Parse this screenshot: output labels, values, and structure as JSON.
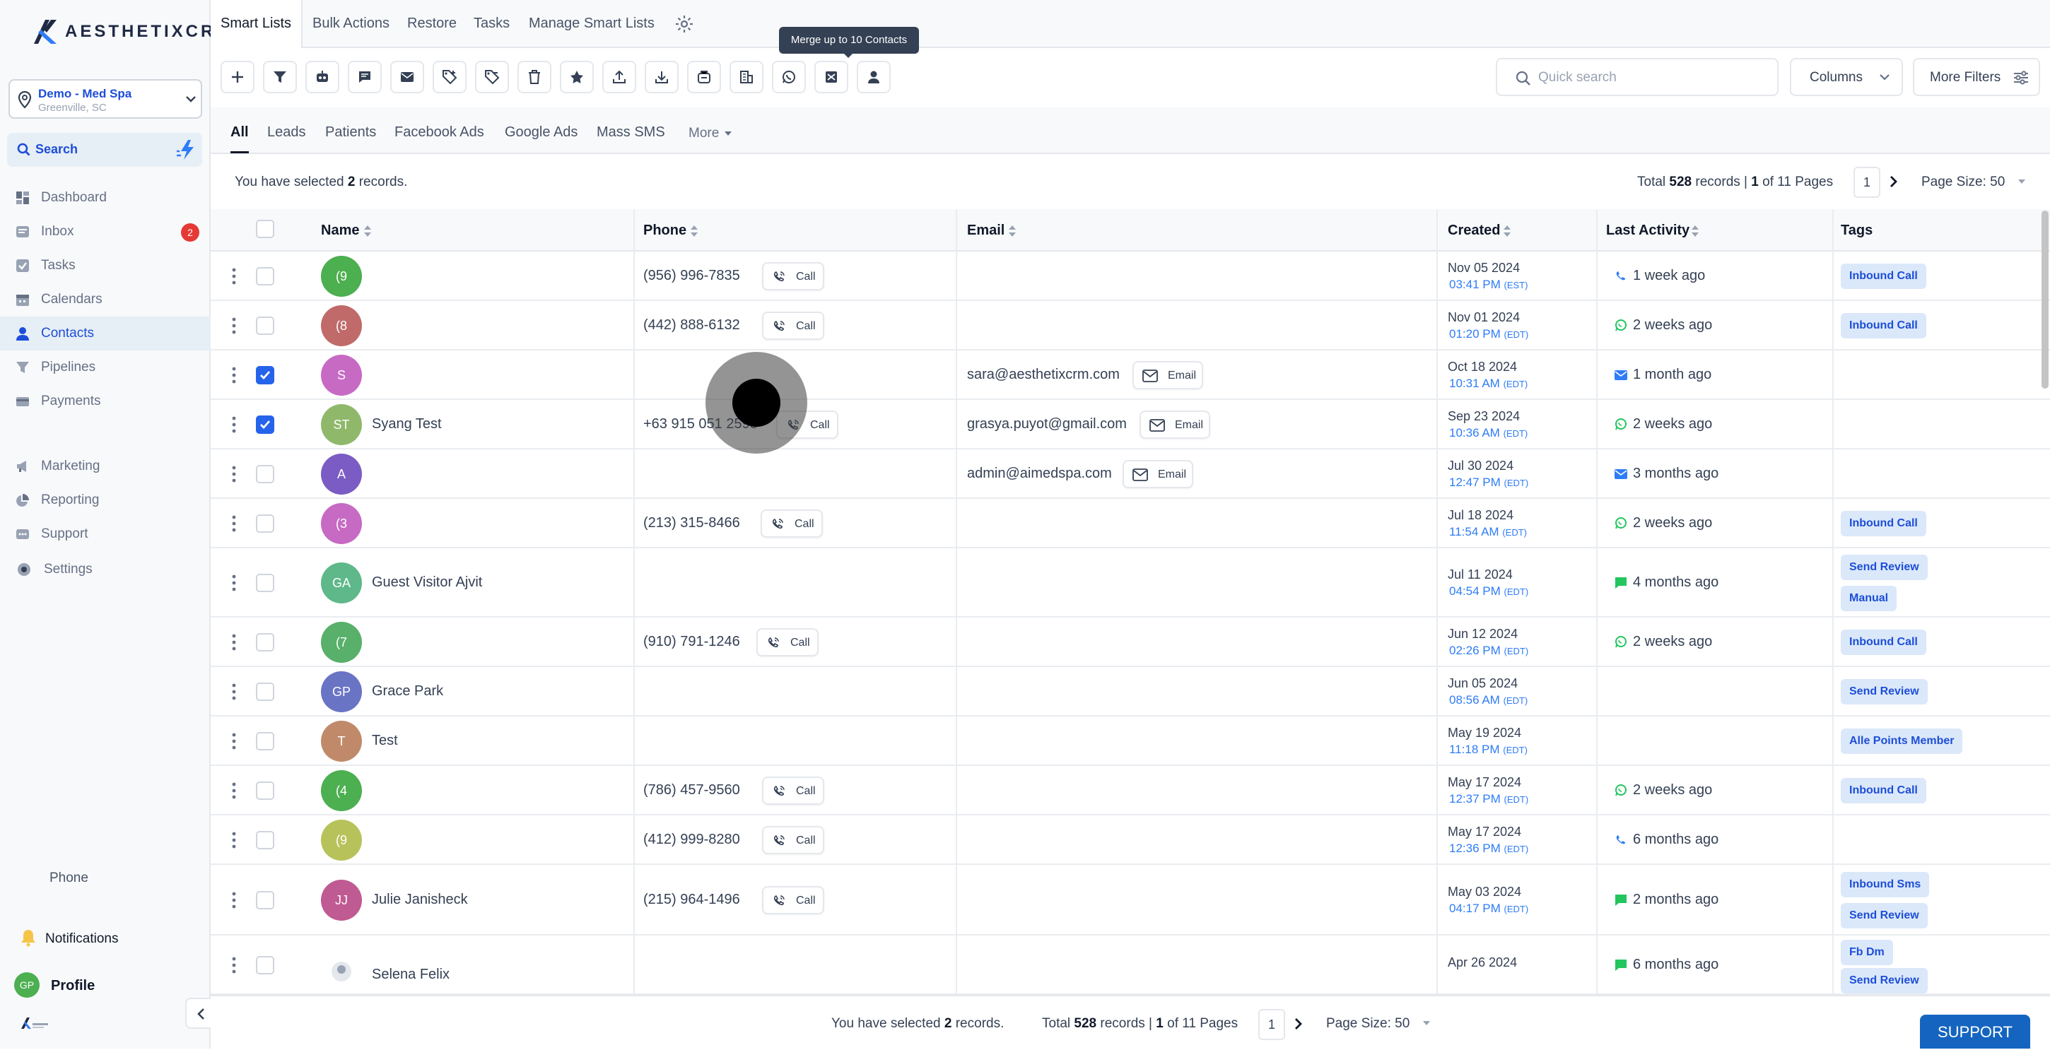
{
  "brand": {
    "logo_text": "AESTHETIXCRM"
  },
  "location": {
    "name": "Demo - Med Spa",
    "city": "Greenville, SC"
  },
  "sidebar": {
    "search_label": "Search",
    "items": [
      {
        "label": "Dashboard"
      },
      {
        "label": "Inbox",
        "badge": "2"
      },
      {
        "label": "Tasks"
      },
      {
        "label": "Calendars"
      },
      {
        "label": "Contacts"
      },
      {
        "label": "Pipelines"
      },
      {
        "label": "Payments"
      },
      {
        "label": "Marketing"
      },
      {
        "label": "Reporting"
      },
      {
        "label": "Support"
      },
      {
        "label": "Settings"
      }
    ],
    "phone_label": "Phone",
    "notifications_label": "Notifications",
    "profile_label": "Profile",
    "profile_initials": "GP"
  },
  "top_tabs": [
    "Smart Lists",
    "Bulk Actions",
    "Restore",
    "Tasks",
    "Manage Smart Lists"
  ],
  "toolbar": {
    "tooltip": "Merge up to 10 Contacts",
    "quick_search_placeholder": "Quick search",
    "columns_label": "Columns",
    "more_filters_label": "More Filters"
  },
  "sub_tabs": [
    "All",
    "Leads",
    "Patients",
    "Facebook Ads",
    "Google Ads",
    "Mass SMS",
    "More"
  ],
  "selection": {
    "prefix": "You have selected",
    "count": "2",
    "suffix": "records."
  },
  "pagination": {
    "total_prefix": "Total",
    "total": "528",
    "records_word": "records |",
    "page": "1",
    "of_text": "of 11 Pages",
    "page_input": "1",
    "page_size": "Page Size: 50"
  },
  "columns": {
    "name": "Name",
    "phone": "Phone",
    "email": "Email",
    "created": "Created",
    "last_activity": "Last Activity",
    "tags": "Tags"
  },
  "call_label": "Call",
  "email_label": "Email",
  "rows": [
    {
      "initials": "(9",
      "name": "",
      "phone": "(956) 996-7835",
      "email": "",
      "date": "Nov 05 2024",
      "time": "03:41 PM",
      "tz": "(EST)",
      "activity": "1 week ago",
      "tags": [
        "Inbound Call"
      ],
      "checked": false
    },
    {
      "initials": "(8",
      "name": "",
      "phone": "(442) 888-6132",
      "email": "",
      "date": "Nov 01 2024",
      "time": "01:20 PM",
      "tz": "(EDT)",
      "activity": "2 weeks ago",
      "tags": [
        "Inbound Call"
      ],
      "checked": false
    },
    {
      "initials": "S",
      "name": "",
      "phone": "",
      "email": "sara@aesthetixcrm.com",
      "date": "Oct 18 2024",
      "time": "10:31 AM",
      "tz": "(EDT)",
      "activity": "1 month ago",
      "tags": [],
      "checked": true
    },
    {
      "initials": "ST",
      "name": "Syang Test",
      "phone": "+63 915 051 2598",
      "email": "grasya.puyot@gmail.com",
      "date": "Sep 23 2024",
      "time": "10:36 AM",
      "tz": "(EDT)",
      "activity": "2 weeks ago",
      "tags": [],
      "checked": true
    },
    {
      "initials": "A",
      "name": "",
      "phone": "",
      "email": "admin@aimedspa.com",
      "date": "Jul 30 2024",
      "time": "12:47 PM",
      "tz": "(EDT)",
      "activity": "3 months ago",
      "tags": [],
      "checked": false
    },
    {
      "initials": "(3",
      "name": "",
      "phone": "(213) 315-8466",
      "email": "",
      "date": "Jul 18 2024",
      "time": "11:54 AM",
      "tz": "(EDT)",
      "activity": "2 weeks ago",
      "tags": [
        "Inbound Call"
      ],
      "checked": false
    },
    {
      "initials": "GA",
      "name": "Guest Visitor Ajvit",
      "phone": "",
      "email": "",
      "date": "Jul 11 2024",
      "time": "04:54 PM",
      "tz": "(EDT)",
      "activity": "4 months ago",
      "tags": [
        "Send Review",
        "Manual"
      ],
      "checked": false
    },
    {
      "initials": "(7",
      "name": "",
      "phone": "(910) 791-1246",
      "email": "",
      "date": "Jun 12 2024",
      "time": "02:26 PM",
      "tz": "(EDT)",
      "activity": "2 weeks ago",
      "tags": [
        "Inbound Call"
      ],
      "checked": false
    },
    {
      "initials": "GP",
      "name": "Grace Park",
      "phone": "",
      "email": "",
      "date": "Jun 05 2024",
      "time": "08:56 AM",
      "tz": "(EDT)",
      "activity": "",
      "tags": [
        "Send Review"
      ],
      "checked": false
    },
    {
      "initials": "T",
      "name": "Test",
      "phone": "",
      "email": "",
      "date": "May 19 2024",
      "time": "11:18 PM",
      "tz": "(EDT)",
      "activity": "",
      "tags": [
        "Alle Points Member"
      ],
      "checked": false
    },
    {
      "initials": "(4",
      "name": "",
      "phone": "(786) 457-9560",
      "email": "",
      "date": "May 17 2024",
      "time": "12:37 PM",
      "tz": "(EDT)",
      "activity": "2 weeks ago",
      "tags": [
        "Inbound Call"
      ],
      "checked": false
    },
    {
      "initials": "(9",
      "name": "",
      "phone": "(412) 999-8280",
      "email": "",
      "date": "May 17 2024",
      "time": "12:36 PM",
      "tz": "(EDT)",
      "activity": "6 months ago",
      "tags": [],
      "checked": false
    },
    {
      "initials": "JJ",
      "name": "Julie Janisheck",
      "phone": "(215) 964-1496",
      "email": "",
      "date": "May 03 2024",
      "time": "04:17 PM",
      "tz": "(EDT)",
      "activity": "2 months ago",
      "tags": [
        "Inbound Sms",
        "Send Review"
      ],
      "checked": false
    },
    {
      "initials": "",
      "name": "Selena Felix",
      "phone": "",
      "email": "",
      "date": "Apr 26 2024",
      "time": "",
      "tz": "",
      "activity": "6 months ago",
      "tags": [
        "Fb Dm",
        "Send Review"
      ],
      "checked": false
    }
  ],
  "support_label": "SUPPORT"
}
